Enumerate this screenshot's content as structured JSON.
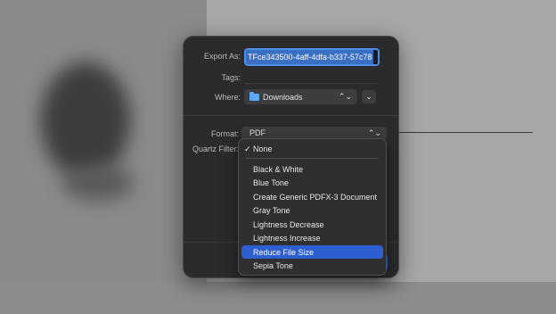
{
  "dialog": {
    "export_label": "Export As:",
    "export_value": "TFce343500-4aff-4dfa-b337-57c78",
    "tags_label": "Tags:",
    "where_label": "Where:",
    "where_value": "Downloads",
    "format_label": "Format:",
    "format_value": "PDF",
    "quartz_label": "Quartz Filter:"
  },
  "menu": {
    "checked_item": "None",
    "items": [
      "Black & White",
      "Blue Tone",
      "Create Generic PDFX-3 Document",
      "Gray Tone",
      "Lightness Decrease",
      "Lightness Increase",
      "Reduce File Size",
      "Sepia Tone"
    ],
    "highlighted_item": "Reduce File Size"
  },
  "colors": {
    "accent": "#2e5fd0",
    "dialog_bg": "#2b2b2d",
    "menu_bg": "#2f2f31"
  },
  "icons": {
    "checkmark": "checkmark-icon",
    "folder": "folder-icon",
    "popup_arrows": "updown-chevron-icon",
    "expand": "chevron-down-icon"
  }
}
